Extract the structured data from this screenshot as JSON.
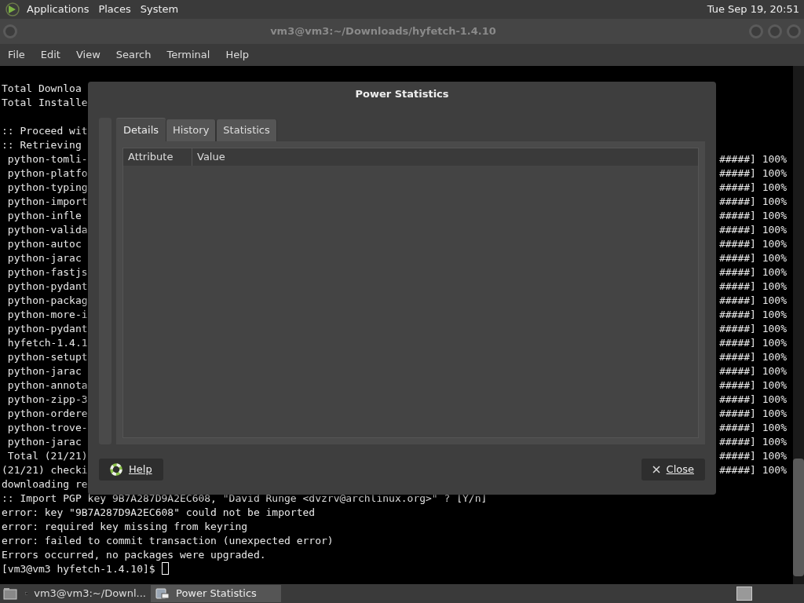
{
  "top_panel": {
    "menus": [
      "Applications",
      "Places",
      "System"
    ],
    "clock": "Tue Sep 19, 20:51"
  },
  "terminal": {
    "title": "vm3@vm3:~/Downloads/hyfetch-1.4.10",
    "menu": [
      "File",
      "Edit",
      "View",
      "Search",
      "Terminal",
      "Help"
    ],
    "lines": [
      {
        "left": "Total Downloa"
      },
      {
        "left": "Total Installe"
      },
      {
        "left": ":: Proceed wit",
        "blank_before": true
      },
      {
        "left": ":: Retrieving"
      },
      {
        "left": " python-tomli-",
        "right": "#####] 100%"
      },
      {
        "left": " python-platfo",
        "right": "#####] 100%"
      },
      {
        "left": " python-typing",
        "right": "#####] 100%"
      },
      {
        "left": " python-import",
        "right": "#####] 100%"
      },
      {
        "left": " python-infle",
        "right": "#####] 100%"
      },
      {
        "left": " python-valida",
        "right": "#####] 100%"
      },
      {
        "left": " python-autoc",
        "right": "#####] 100%"
      },
      {
        "left": " python-jarac",
        "right": "#####] 100%"
      },
      {
        "left": " python-fastjs",
        "right": "#####] 100%"
      },
      {
        "left": " python-pydant",
        "right": "#####] 100%"
      },
      {
        "left": " python-packag",
        "right": "#####] 100%"
      },
      {
        "left": " python-more-i",
        "right": "#####] 100%"
      },
      {
        "left": " python-pydant",
        "right": "#####] 100%"
      },
      {
        "left": " hyfetch-1.4.1",
        "right": "#####] 100%"
      },
      {
        "left": " python-setupt",
        "right": "#####] 100%"
      },
      {
        "left": " python-jarac",
        "right": "#####] 100%"
      },
      {
        "left": " python-annota",
        "right": "#####] 100%"
      },
      {
        "left": " python-zipp-3",
        "right": "#####] 100%"
      },
      {
        "left": " python-ordere",
        "right": "#####] 100%"
      },
      {
        "left": " python-trove-",
        "right": "#####] 100%"
      },
      {
        "left": " python-jarac",
        "right": "#####] 100%"
      },
      {
        "left": " Total (21/21)",
        "right": "#####] 100%"
      },
      {
        "left": "(21/21) checki",
        "right": "#####] 100%"
      },
      {
        "left": "downloading re"
      },
      {
        "left": ":: Import PGP key 9B7A287D9A2EC608, \"David Runge <dvzrv@archlinux.org>\" ? [Y/n]"
      },
      {
        "left": "error: key \"9B7A287D9A2EC608\" could not be imported"
      },
      {
        "left": "error: required key missing from keyring"
      },
      {
        "left": "error: failed to commit transaction (unexpected error)"
      },
      {
        "left": "Errors occurred, no packages were upgraded."
      },
      {
        "left": "[vm3@vm3 hyfetch-1.4.10]$ ",
        "cursor": true
      }
    ]
  },
  "dialog": {
    "title": "Power Statistics",
    "tabs": [
      {
        "label": "Details",
        "selected": true
      },
      {
        "label": "History",
        "selected": false
      },
      {
        "label": "Statistics",
        "selected": false
      }
    ],
    "columns": [
      "Attribute",
      "Value"
    ],
    "help_button": "Help",
    "close_button": "Close"
  },
  "taskbar": {
    "items": [
      {
        "kind": "terminal",
        "label": "vm3@vm3:~/Downl...",
        "selected": false
      },
      {
        "kind": "power",
        "label": "Power Statistics",
        "selected": true
      }
    ]
  }
}
